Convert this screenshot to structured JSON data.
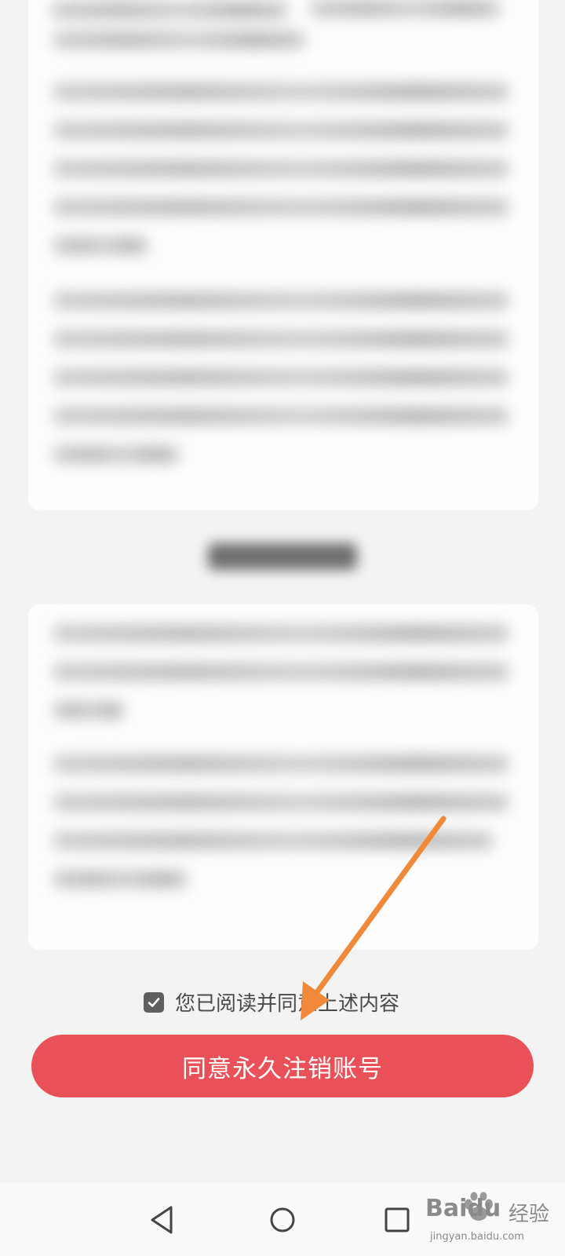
{
  "agreement": {
    "checked": true,
    "label": "您已阅读并同意上述内容"
  },
  "confirm_button": {
    "label": "同意永久注销账号"
  },
  "navbar": {
    "icons": [
      "back-triangle-icon",
      "home-circle-icon",
      "recents-square-icon"
    ]
  },
  "watermark": {
    "brand": "Baidu",
    "brand_suffix": "经验",
    "url": "jingyan.baidu.com"
  },
  "colors": {
    "button": "#e95057",
    "annotation_arrow": "#f08a3a",
    "background": "#f3f3f3"
  }
}
